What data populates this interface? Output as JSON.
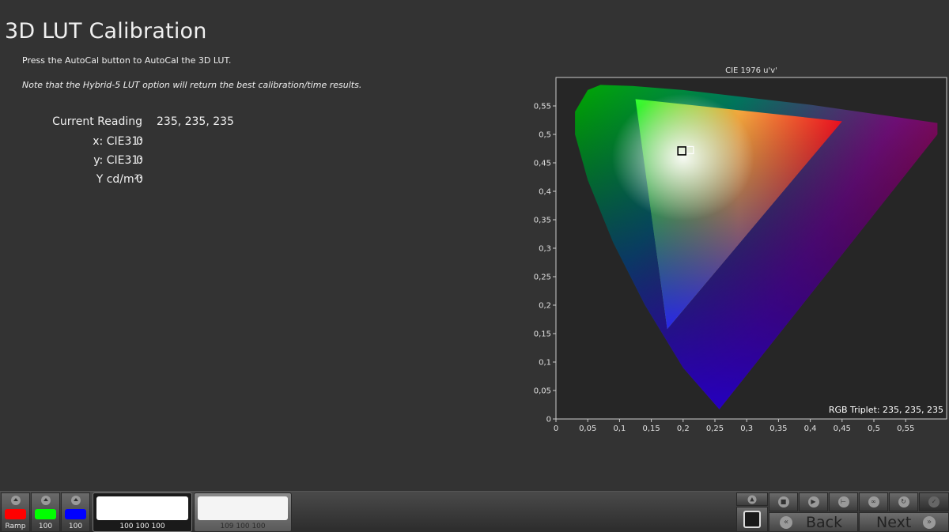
{
  "page": {
    "title": "3D LUT Calibration",
    "instruction": "Press the AutoCal button to AutoCal the 3D LUT.",
    "note": "Note that the Hybrid-5 LUT option will return the best calibration/time results."
  },
  "readings": {
    "current_label": "Current Reading",
    "current_value": "235, 235, 235",
    "rows": [
      {
        "label": "x: CIE31:",
        "value": "0"
      },
      {
        "label": "y: CIE31:",
        "value": "0"
      },
      {
        "label": "Y cd/m²:",
        "value": "0"
      }
    ]
  },
  "chart_data": {
    "type": "scatter",
    "title": "CIE 1976 u'v'",
    "xlim": [
      0,
      0.6
    ],
    "ylim": [
      0,
      0.6
    ],
    "x_ticks": [
      "0",
      "0,05",
      "0,1",
      "0,15",
      "0,2",
      "0,25",
      "0,3",
      "0,35",
      "0,4",
      "0,45",
      "0,5",
      "0,55"
    ],
    "y_ticks": [
      "0",
      "0,05",
      "0,1",
      "0,15",
      "0,2",
      "0,25",
      "0,3",
      "0,35",
      "0,4",
      "0,45",
      "0,5",
      "0,55"
    ],
    "gamut_triangle": {
      "red": [
        0.45,
        0.523
      ],
      "green": [
        0.125,
        0.562
      ],
      "blue": [
        0.175,
        0.158
      ]
    },
    "target_point": {
      "u": 0.21,
      "v": 0.473
    },
    "measured_point": {
      "u": 0.198,
      "v": 0.471
    },
    "annotation": "RGB Triplet: 235, 235, 235"
  },
  "bottom": {
    "swatches": [
      {
        "color": "#ff0000",
        "label": "Ramp"
      },
      {
        "color": "#00ff00",
        "label": "100"
      },
      {
        "color": "#0000ff",
        "label": "100"
      }
    ],
    "patches": [
      {
        "label": "100 100 100"
      },
      {
        "label": "109 100 100"
      }
    ],
    "controls": {
      "icons": [
        "up-arrow-icon",
        "stop-icon",
        "play-icon",
        "range-icon",
        "loop-icon",
        "refresh-icon",
        "check-icon"
      ]
    },
    "back_label": "Back",
    "next_label": "Next",
    "back_glyph": "«",
    "next_glyph": "»"
  }
}
